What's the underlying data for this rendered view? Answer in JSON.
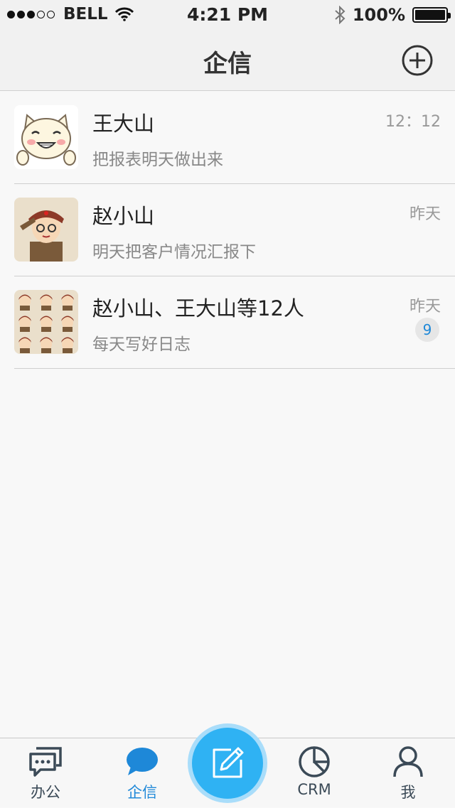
{
  "status_bar": {
    "carrier": "BELL",
    "time": "4:21 PM",
    "battery": "100%",
    "signal_bars": 3
  },
  "nav": {
    "title": "企信"
  },
  "conversations": [
    {
      "name": "王大山",
      "preview": "把报表明天做出来",
      "time": "12：12",
      "avatar": "smiling-cat-avatar"
    },
    {
      "name": "赵小山",
      "preview": "明天把客户情况汇报下",
      "time": "昨天",
      "avatar": "saluting-soldier-avatar"
    },
    {
      "name": "赵小山、王大山等12人",
      "preview": "每天写好日志",
      "time": "昨天",
      "badge": "9",
      "avatar": "group-grid-avatar"
    }
  ],
  "tab_bar": {
    "tabs": [
      {
        "label": "办公",
        "icon": "chat-bubbles-icon"
      },
      {
        "label": "企信",
        "icon": "speech-bubble-icon",
        "active": true
      },
      {
        "label": "CRM",
        "icon": "pie-chart-icon"
      },
      {
        "label": "我",
        "icon": "person-icon"
      }
    ],
    "compose_icon": "edit-pencil-icon",
    "accent_color": "#1e88d8"
  }
}
